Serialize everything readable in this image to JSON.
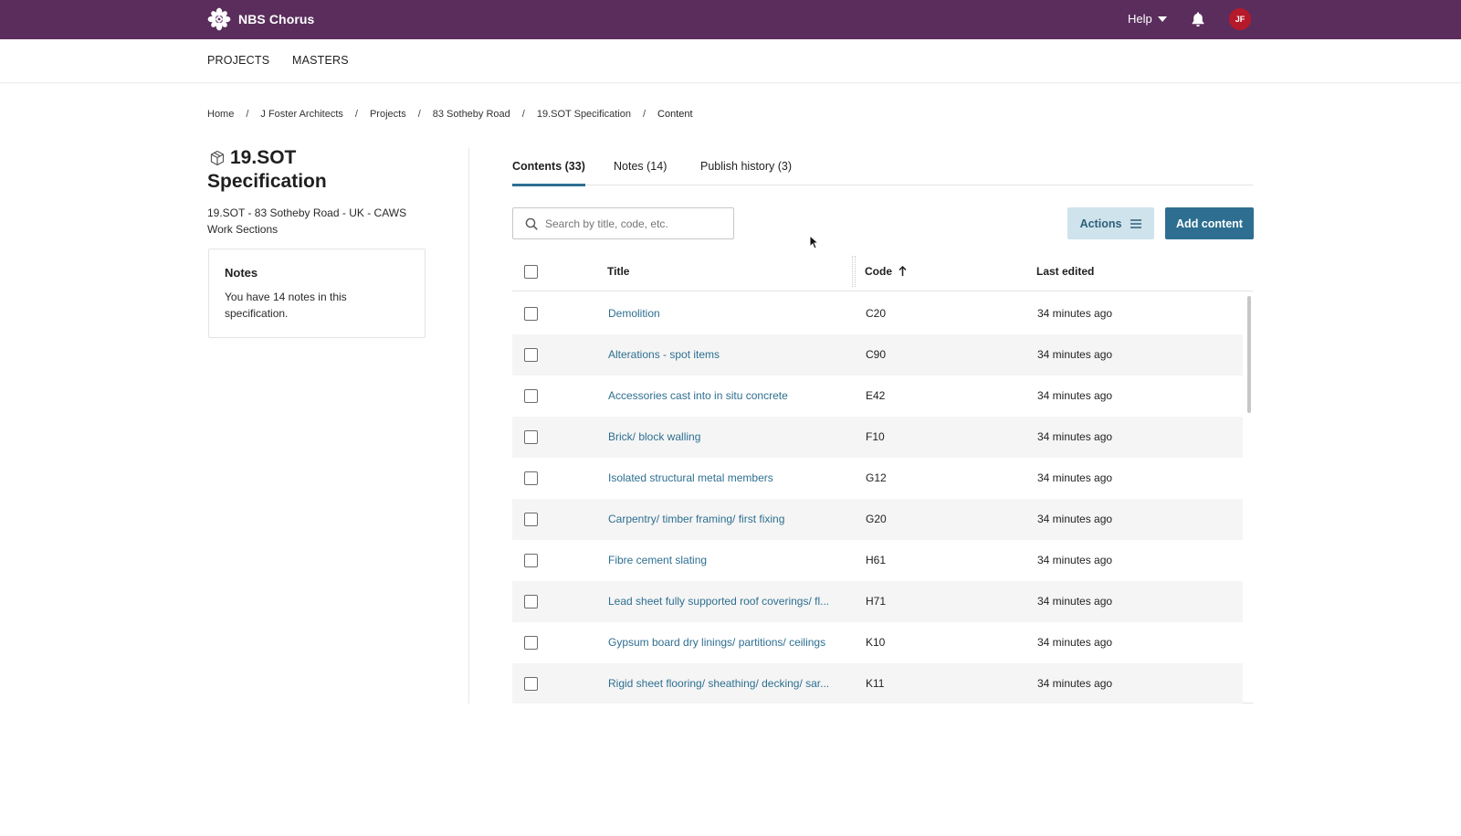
{
  "app": {
    "name": "NBS Chorus",
    "user_initials": "JF",
    "help_label": "Help"
  },
  "subnav": {
    "items": [
      "PROJECTS",
      "MASTERS"
    ]
  },
  "breadcrumb": [
    "Home",
    "J Foster Architects",
    "Projects",
    "83 Sotheby Road",
    "19.SOT Specification",
    "Content"
  ],
  "spec": {
    "title_line1": "19.SOT",
    "title_line2": "Specification",
    "subtitle": "19.SOT - 83 Sotheby Road - UK - CAWS Work Sections"
  },
  "notes_card": {
    "heading": "Notes",
    "text": "You have 14 notes in this specification."
  },
  "tabs": [
    {
      "label": "Contents (33)",
      "active": true
    },
    {
      "label": "Notes (14)",
      "active": false
    },
    {
      "label": "Publish history (3)",
      "active": false
    }
  ],
  "search": {
    "placeholder": "Search by title, code, etc.",
    "value": ""
  },
  "toolbar": {
    "actions_label": "Actions",
    "add_label": "Add content"
  },
  "table": {
    "columns": [
      "Title",
      "Code",
      "Last edited"
    ],
    "sort_column": "Code",
    "sort_direction": "ascending",
    "rows": [
      {
        "title": "Demolition",
        "code": "C20",
        "edited": "34 minutes ago"
      },
      {
        "title": "Alterations - spot items",
        "code": "C90",
        "edited": "34 minutes ago"
      },
      {
        "title": "Accessories cast into in situ concrete",
        "code": "E42",
        "edited": "34 minutes ago"
      },
      {
        "title": "Brick/ block walling",
        "code": "F10",
        "edited": "34 minutes ago"
      },
      {
        "title": "Isolated structural metal members",
        "code": "G12",
        "edited": "34 minutes ago"
      },
      {
        "title": "Carpentry/ timber framing/ first fixing",
        "code": "G20",
        "edited": "34 minutes ago"
      },
      {
        "title": "Fibre cement slating",
        "code": "H61",
        "edited": "34 minutes ago"
      },
      {
        "title": "Lead sheet fully supported roof coverings/ fl...",
        "code": "H71",
        "edited": "34 minutes ago"
      },
      {
        "title": "Gypsum board dry linings/ partitions/ ceilings",
        "code": "K10",
        "edited": "34 minutes ago"
      },
      {
        "title": "Rigid sheet flooring/ sheathing/ decking/ sar...",
        "code": "K11",
        "edited": "34 minutes ago"
      }
    ]
  },
  "colors": {
    "header_bg": "#5a2d5c",
    "link": "#2e6f91",
    "primary_button": "#2e6f91",
    "secondary_button": "#cfe3ec",
    "avatar_bg": "#b5192a"
  },
  "icons": [
    "nbs-logo-icon",
    "bell-icon",
    "caret-down-icon",
    "cube-icon",
    "search-icon",
    "menu-icon",
    "sort-up-icon",
    "mouse-pointer-icon"
  ]
}
